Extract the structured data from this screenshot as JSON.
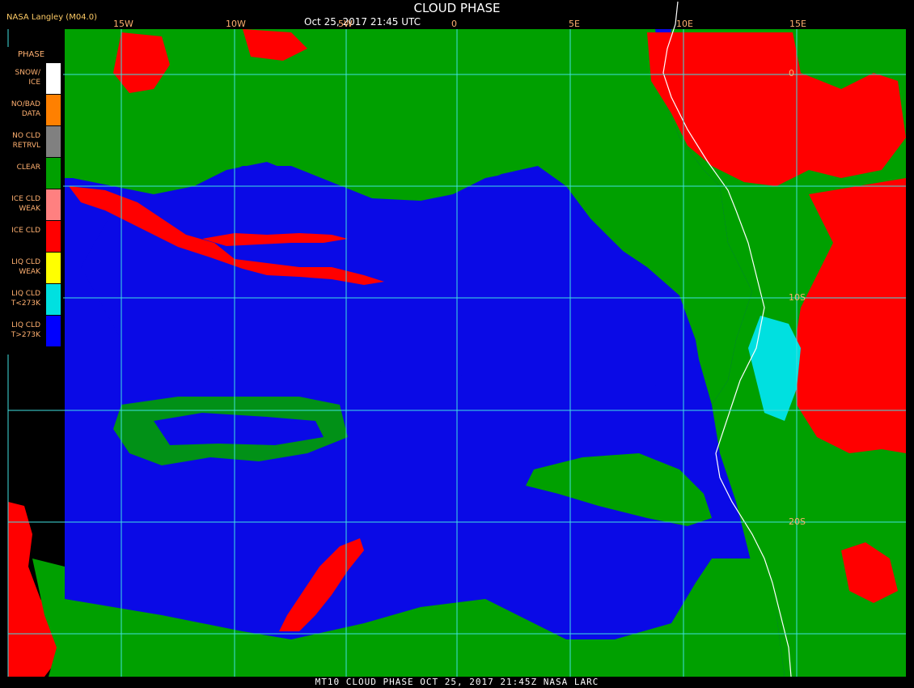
{
  "header": {
    "brand": "NASA Langley (M04.0)",
    "title": "CLOUD PHASE",
    "timestamp": "Oct 25, 2017 21:45 UTC"
  },
  "longitude_labels": [
    "15W",
    "10W",
    "5W",
    "0",
    "5E",
    "10E",
    "15E"
  ],
  "latitude_labels": [
    "0",
    "10S",
    "20S"
  ],
  "legend": {
    "title": "PHASE",
    "items": [
      {
        "label": "SNOW/\nICE",
        "color": "#ffffff"
      },
      {
        "label": "NO/BAD\nDATA",
        "color": "#ff8000"
      },
      {
        "label": "NO CLD\nRETRVL",
        "color": "#808080"
      },
      {
        "label": "CLEAR",
        "color": "#00a000"
      },
      {
        "label": "ICE CLD\nWEAK",
        "color": "#ff8080"
      },
      {
        "label": "ICE CLD",
        "color": "#ff0000"
      },
      {
        "label": "LIQ CLD\nWEAK",
        "color": "#ffff00"
      },
      {
        "label": "LIQ CLD\nT<273K",
        "color": "#00e0e0"
      },
      {
        "label": "LIQ CLD\nT>273K",
        "color": "#0000ff"
      }
    ]
  },
  "footer": "MT10  CLOUD PHASE   OCT 25, 2017 21:45Z   NASA LARC",
  "colors": {
    "ocean_liquid": "#0a0ae6",
    "clear": "#00a000",
    "ice": "#ff0000",
    "cold_liquid": "#00e0e0",
    "grid": "#40e0e0",
    "coast": "#ffffff"
  }
}
